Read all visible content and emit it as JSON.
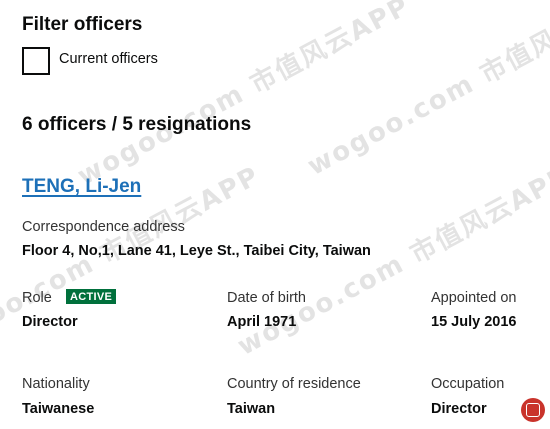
{
  "filter": {
    "heading": "Filter officers",
    "checkbox_label": "Current officers",
    "checked": false
  },
  "summary": {
    "count_text": "6 officers / 5 resignations"
  },
  "officer": {
    "name": "TENG, Li-Jen",
    "address_label": "Correspondence address",
    "address": "Floor 4, No,1, Lane 41, Leye St., Taibei City, Taiwan",
    "role_label": "Role",
    "status_badge": "ACTIVE",
    "role": "Director",
    "dob_label": "Date of birth",
    "dob": "April 1971",
    "appointed_label": "Appointed on",
    "appointed": "15 July 2016",
    "nationality_label": "Nationality",
    "nationality": "Taiwanese",
    "residence_label": "Country of residence",
    "residence": "Taiwan",
    "occupation_label": "Occupation",
    "occupation": "Director"
  },
  "watermark": {
    "text": "wogoo.com 市值风云APP"
  },
  "colors": {
    "link": "#1d70b8",
    "badge": "#00703c",
    "seal": "#c9332b"
  }
}
